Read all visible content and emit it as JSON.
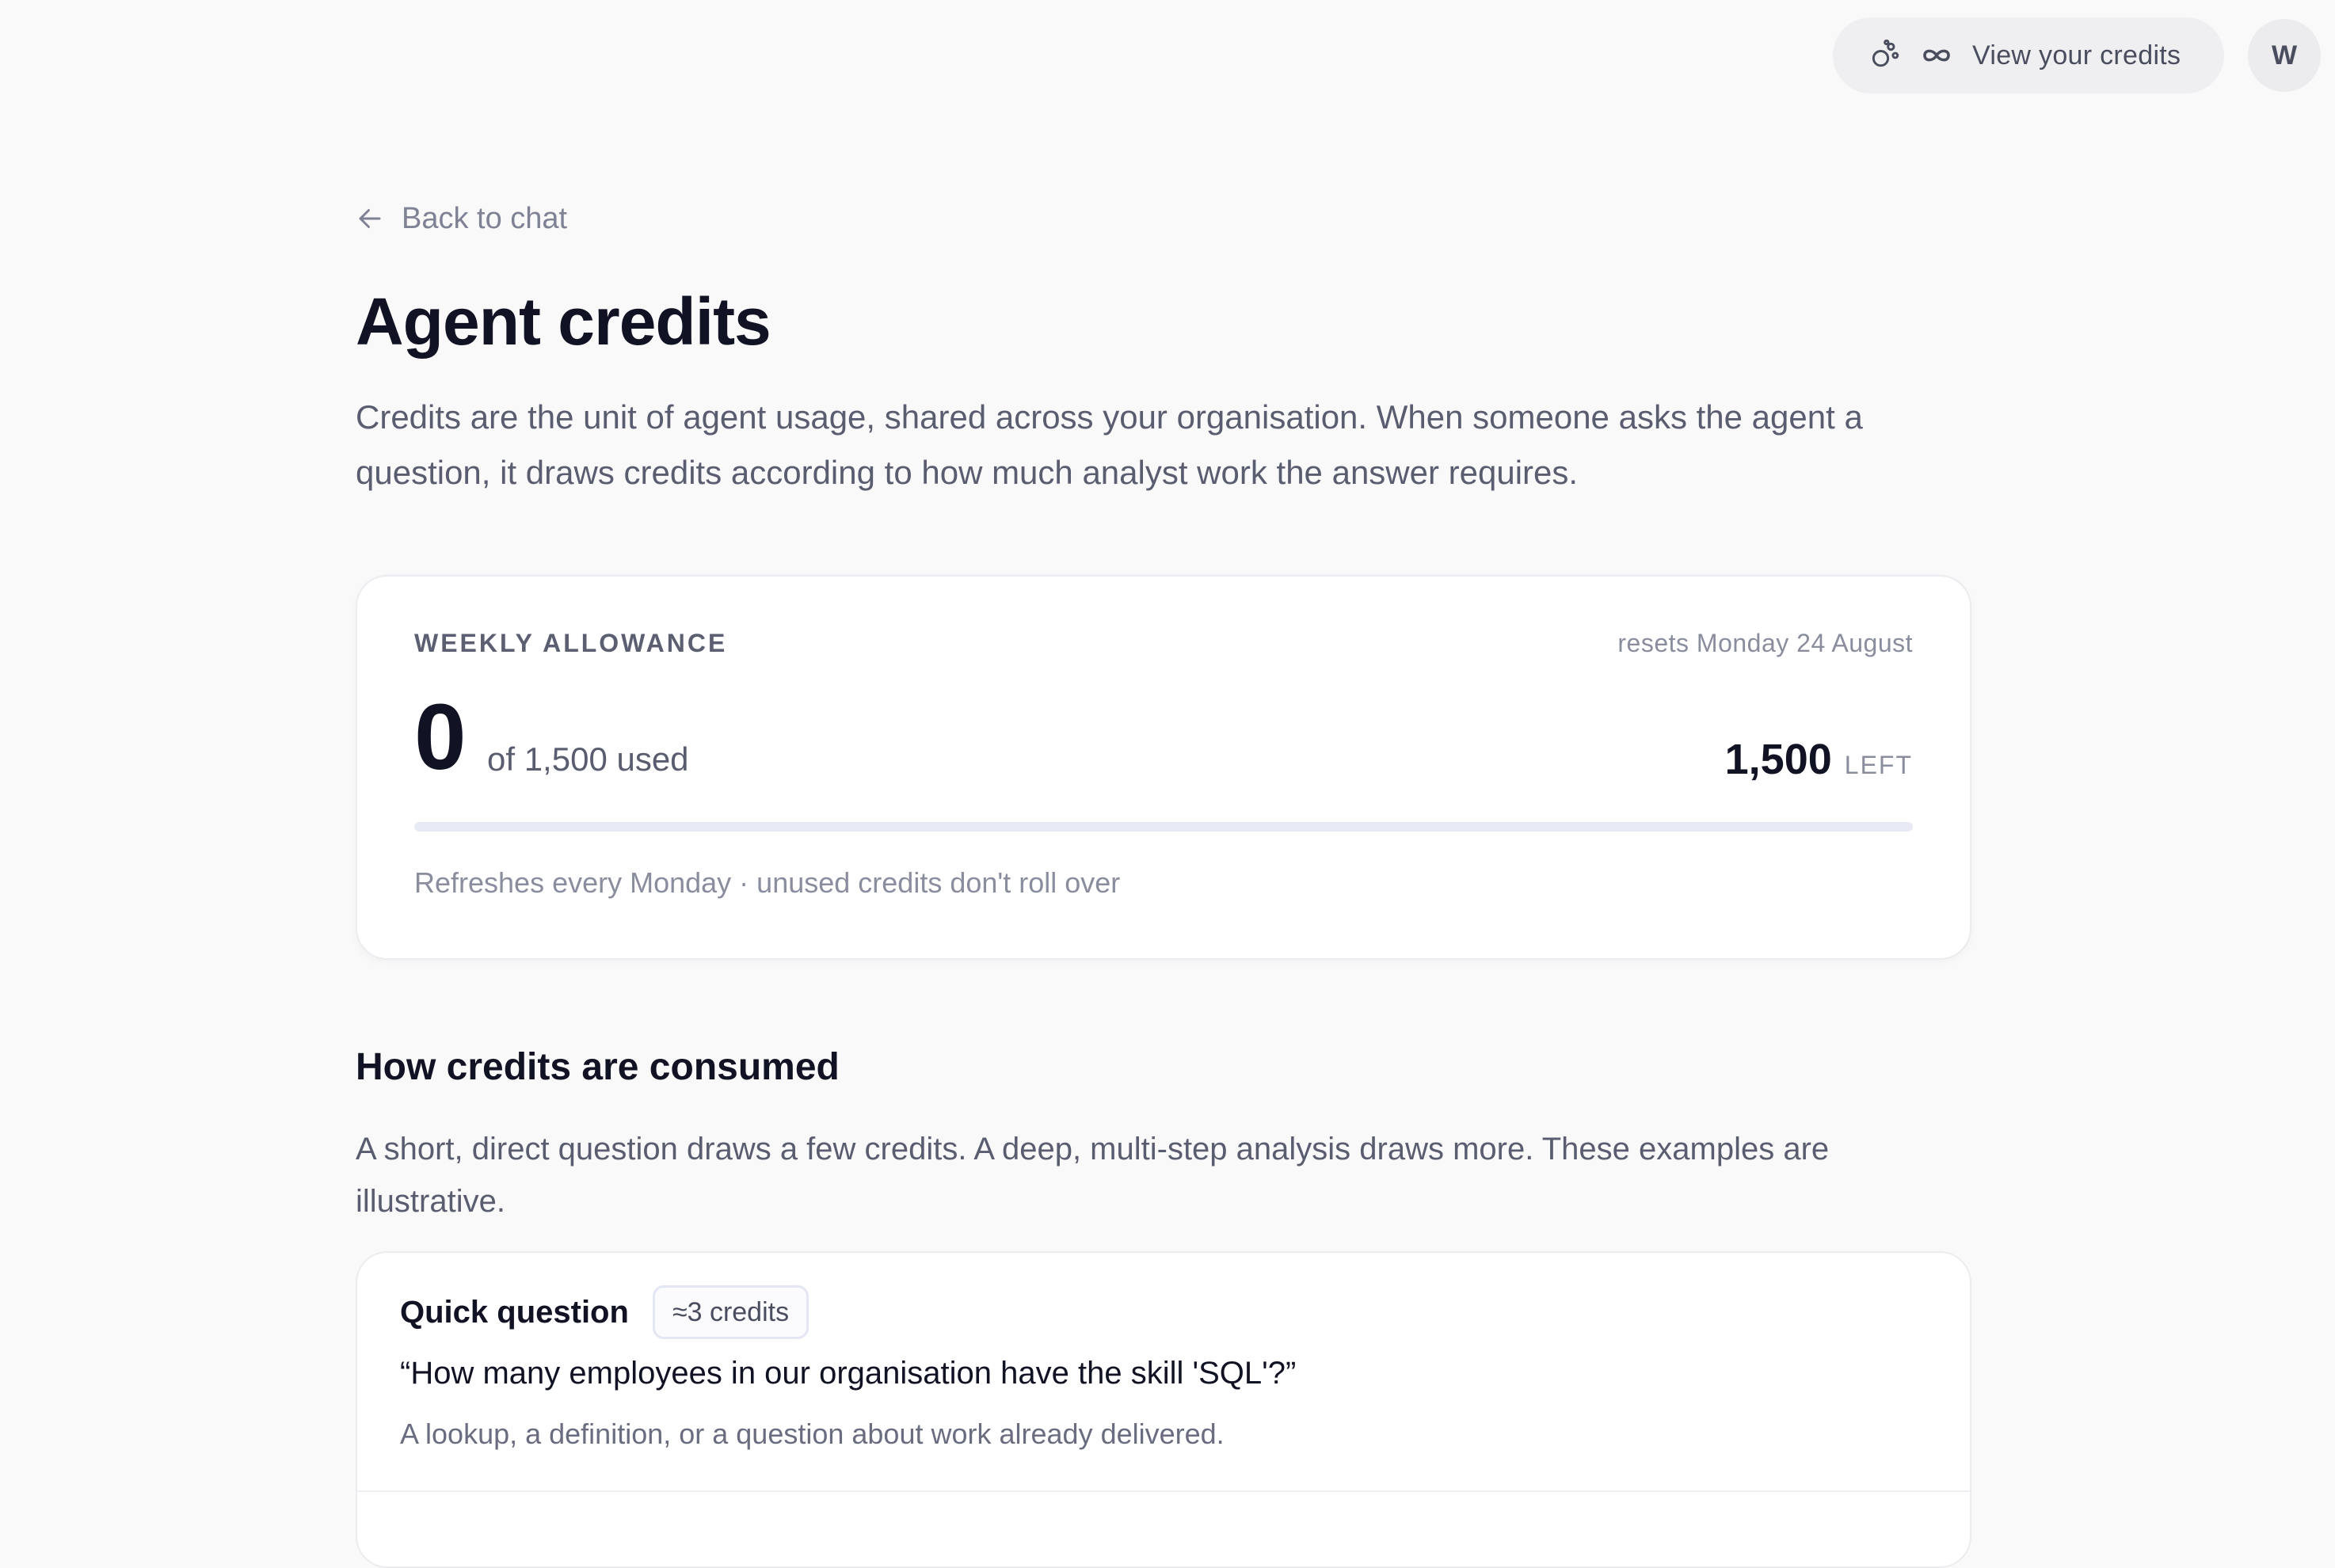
{
  "header": {
    "credits_button_label": "View your credits",
    "credits_icon": "agent-icon",
    "infinity_icon": "infinity-icon",
    "avatar_initial": "W"
  },
  "nav": {
    "back_label": "Back to chat",
    "back_icon": "arrow-left-icon"
  },
  "page": {
    "title": "Agent credits",
    "description": "Credits are the unit of agent usage, shared across your organisation. When someone asks the agent a question, it draws credits according to how much analyst work the answer requires."
  },
  "allowance": {
    "label": "WEEKLY ALLOWANCE",
    "resets": "resets Monday 24 August",
    "used": "0",
    "of_total": "of 1,500 used",
    "left_value": "1,500",
    "left_label": "LEFT",
    "progress_fraction": 0,
    "note": "Refreshes every Monday · unused credits don't roll over"
  },
  "consumption": {
    "title": "How credits are consumed",
    "description": "A short, direct question draws a few credits. A deep, multi-step analysis draws more. These examples are illustrative.",
    "examples": [
      {
        "title": "Quick question",
        "badge": "≈3 credits",
        "quote": "“How many employees in our organisation have the skill 'SQL'?”",
        "note": "A lookup, a definition, or a question about work already delivered."
      }
    ]
  },
  "colors": {
    "accent": "#5b63d6",
    "track": "#e8eaf6",
    "text_primary": "#121225",
    "text_secondary": "#5a5d70"
  }
}
